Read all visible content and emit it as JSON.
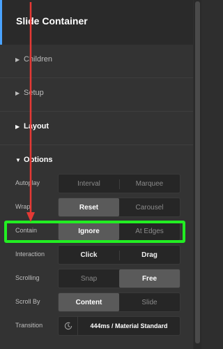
{
  "header": {
    "title": "Slide Container"
  },
  "sections": [
    {
      "label": "Children",
      "state": "collapsed"
    },
    {
      "label": "Setup",
      "state": "collapsed"
    },
    {
      "label": "Layout",
      "state": "collapsed"
    },
    {
      "label": "Options",
      "state": "expanded"
    }
  ],
  "options": {
    "autoplay": {
      "label": "Autoplay",
      "choices": [
        "Interval",
        "Marquee"
      ]
    },
    "wrap": {
      "label": "Wrap",
      "choices": [
        "Reset",
        "Carousel"
      ],
      "selected": "Reset"
    },
    "contain": {
      "label": "Contain",
      "choices": [
        "Ignore",
        "At Edges"
      ],
      "selected": "Ignore"
    },
    "interaction": {
      "label": "Interaction",
      "choices": [
        "Click",
        "Drag"
      ]
    },
    "scrolling": {
      "label": "Scrolling",
      "choices": [
        "Snap",
        "Free"
      ],
      "selected": "Free"
    },
    "scroll_by": {
      "label": "Scroll By",
      "choices": [
        "Content",
        "Slide"
      ],
      "selected": "Content"
    },
    "transition": {
      "label": "Transition",
      "value": "444ms / Material Standard",
      "icon": "clock-icon"
    }
  },
  "annotations": {
    "highlight_color": "#22ee22",
    "arrow_color": "#e53935"
  },
  "colors": {
    "accent": "#4aa3ff",
    "panel_bg": "#333333"
  }
}
